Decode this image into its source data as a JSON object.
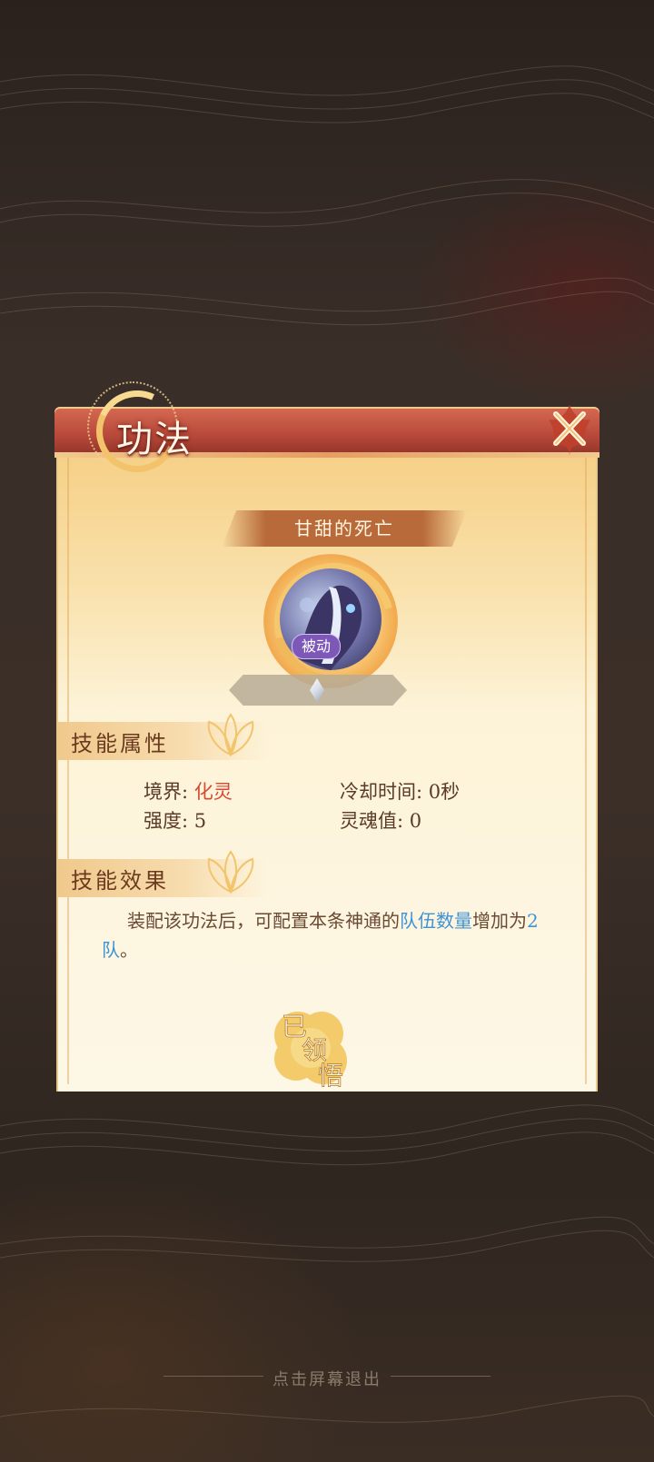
{
  "dialog": {
    "title": "功法",
    "skill_name": "甘甜的死亡",
    "skill_type_tag": "被动",
    "sections": {
      "attributes": {
        "title": "技能属性",
        "realm_label": "境界: ",
        "realm_value": "化灵",
        "cooldown": "冷却时间: 0秒",
        "strength": "强度: 5",
        "soul_value": "灵魂值: 0"
      },
      "effect": {
        "title": "技能效果",
        "text_part1": "装配该功法后，可配置本条神通的",
        "highlight1": "队伍数量",
        "text_part2": "增加为",
        "highlight2": "2队",
        "text_part3": "。"
      }
    },
    "learned_seal": [
      "已",
      "领",
      "悟"
    ]
  },
  "footer": {
    "exit_hint": "点击屏幕退出"
  },
  "colors": {
    "accent_red": "#d34b32",
    "highlight_blue": "#3e93d6",
    "title_bar": "#b94a3b",
    "passive_tag": "#7d58b8"
  },
  "icons": [
    "close-icon",
    "moon-emblem-icon",
    "skill-portrait-icon",
    "level-gem-icon",
    "lotus-icon",
    "learned-seal-icon"
  ]
}
